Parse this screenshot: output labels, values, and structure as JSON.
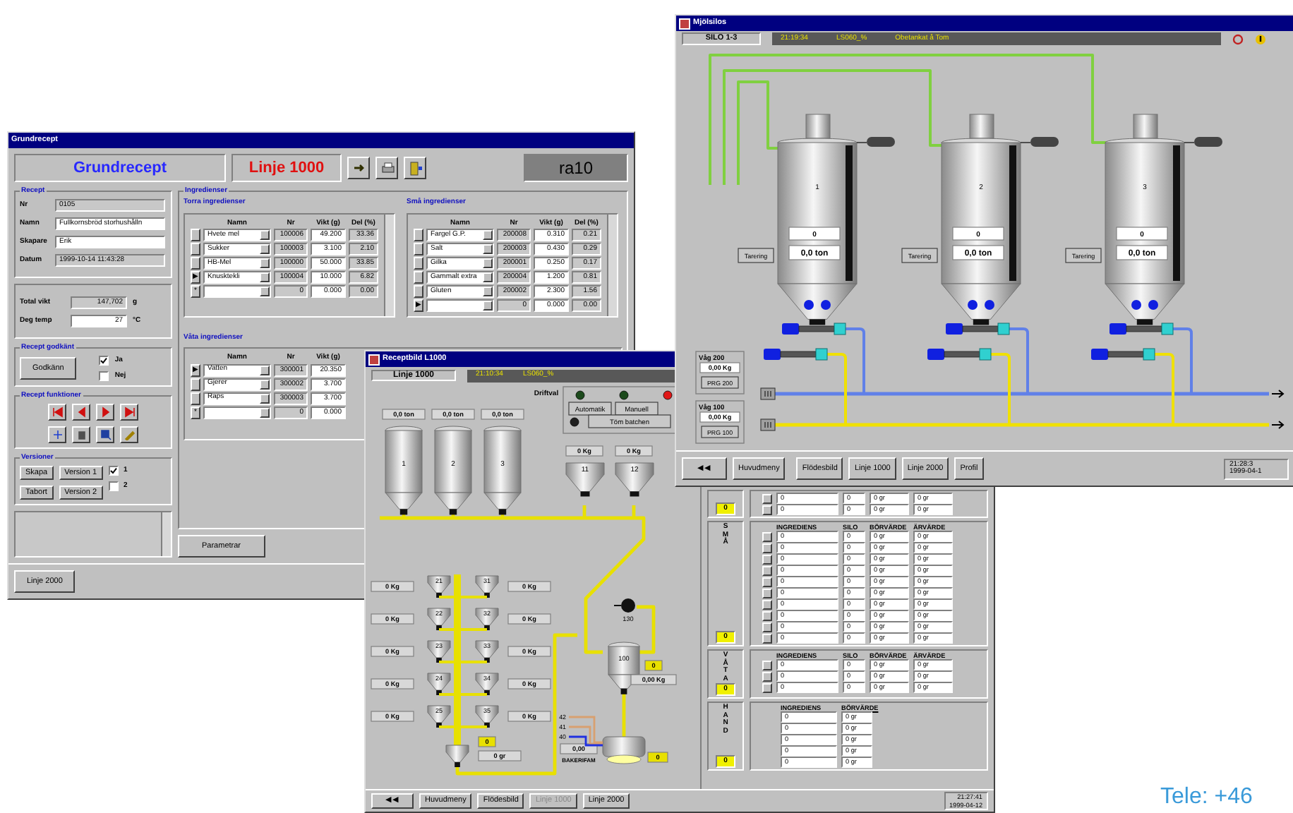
{
  "windows": [
    {
      "kind": "recipe",
      "title": "Grundrecept",
      "heading": "Grundrecept",
      "line": "Linje 1000",
      "code": "ra10",
      "recept": {
        "legend": "Recept",
        "fields": [
          {
            "label": "Nr",
            "value": "0105",
            "editable": false
          },
          {
            "label": "Namn",
            "value": "Fullkornsbröd storhushålln",
            "editable": true
          },
          {
            "label": "Skapare",
            "value": "Erik",
            "editable": true
          },
          {
            "label": "Datum",
            "value": "1999-10-14 11:43:28",
            "editable": false
          }
        ]
      },
      "totals": [
        {
          "label": "Total vikt",
          "value": "147,702",
          "unit": "g",
          "editable": false
        },
        {
          "label": "Deg temp",
          "value": "27",
          "unit": "°C",
          "editable": true
        }
      ],
      "approval": {
        "legend": "Recept godkänt",
        "button": "Godkänn",
        "options": [
          {
            "label": "Ja",
            "checked": true
          },
          {
            "label": "Nej",
            "checked": false
          }
        ]
      },
      "functions": {
        "legend": "Recept funktioner"
      },
      "versions": {
        "legend": "Versioner",
        "buttons": [
          "Skapa",
          "Version 1",
          "Tabort",
          "Version 2"
        ],
        "options": [
          {
            "label": "1",
            "checked": true
          },
          {
            "label": "2",
            "checked": false
          }
        ]
      },
      "parameters_button": "Parametrar",
      "footer_button": "Linje 2000",
      "ingredients": {
        "legend": "Ingredienser",
        "tables": [
          {
            "title": "Torra ingredienser",
            "columns": [
              "Namn",
              "Nr",
              "Vikt (g)",
              "Del (%)"
            ],
            "rows": [
              {
                "name": "Hvete mel",
                "nr": "100006",
                "weight": "49.200",
                "share": "33.36"
              },
              {
                "name": "Sukker",
                "nr": "100003",
                "weight": "3.100",
                "share": "2.10"
              },
              {
                "name": "HB-Mel",
                "nr": "100000",
                "weight": "50.000",
                "share": "33.85"
              },
              {
                "marker": "▶",
                "name": "Knusktekli",
                "nr": "100004",
                "weight": "10.000",
                "share": "6.82"
              },
              {
                "marker": "*",
                "nr": "0",
                "weight": "0.000",
                "share": "0.00"
              }
            ]
          },
          {
            "title": "Små ingredienser",
            "columns": [
              "Namn",
              "Nr",
              "Vikt (g)",
              "Del (%)"
            ],
            "rows": [
              {
                "name": "Fargel G.P.",
                "nr": "200008",
                "weight": "0.310",
                "share": "0.21"
              },
              {
                "name": "Salt",
                "nr": "200003",
                "weight": "0.430",
                "share": "0.29"
              },
              {
                "name": "Gilka",
                "nr": "200001",
                "weight": "0.250",
                "share": "0.17"
              },
              {
                "name": "Gammalt extra",
                "nr": "200004",
                "weight": "1.200",
                "share": "0.81"
              },
              {
                "name": "Gluten",
                "nr": "200002",
                "weight": "2.300",
                "share": "1.56"
              },
              {
                "marker": "▶",
                "nr": "0",
                "weight": "0.000",
                "share": "0.00"
              }
            ]
          },
          {
            "title": "Våta ingredienser",
            "columns": [
              "Namn",
              "Nr",
              "Vikt (g)"
            ],
            "rows": [
              {
                "marker": "▶",
                "name": "Vatten",
                "nr": "300001",
                "weight": "20.350"
              },
              {
                "name": "Gjerer",
                "nr": "300002",
                "weight": "3.700"
              },
              {
                "name": "Raps",
                "nr": "300003",
                "weight": "3.700"
              },
              {
                "marker": "*",
                "nr": "0",
                "weight": "0.000"
              }
            ]
          }
        ]
      }
    },
    {
      "kind": "process",
      "title": "Receptbild L1000",
      "line": "Linje 1000",
      "status": [
        "21:10:34",
        "LS060_%"
      ],
      "mode": {
        "label": "Driftval",
        "lamps": [
          {
            "color": "#1c4a1c"
          },
          {
            "color": "#1c4a1c"
          },
          {
            "color": "#e01818"
          },
          {
            "color": "#202020"
          }
        ],
        "buttons": [
          "Automatik",
          "Manuell"
        ],
        "wide_button": "Töm batchen"
      },
      "silos": [
        {
          "label": "1",
          "reading": "0,0 ton"
        },
        {
          "label": "2",
          "reading": "0,0 ton"
        },
        {
          "label": "3",
          "reading": "0,0 ton"
        }
      ],
      "hoppers": [
        {
          "label": "11",
          "reading": "0 Kg"
        },
        {
          "label": "12",
          "reading": "0 Kg"
        }
      ],
      "small_hoppers_left": [
        {
          "label": "21",
          "reading": "0 Kg"
        },
        {
          "label": "22",
          "reading": "0 Kg"
        },
        {
          "label": "23",
          "reading": "0 Kg"
        },
        {
          "label": "24",
          "reading": "0 Kg"
        },
        {
          "label": "25",
          "reading": "0 Kg"
        }
      ],
      "small_hoppers_right": [
        {
          "label": "31",
          "reading": "0 Kg"
        },
        {
          "label": "32",
          "reading": "0 Kg"
        },
        {
          "label": "33",
          "reading": "0 Kg"
        },
        {
          "label": "34",
          "reading": "0 Kg"
        },
        {
          "label": "35",
          "reading": "0 Kg"
        }
      ],
      "collector": {
        "counter": "0",
        "reading": "0 gr"
      },
      "scale": {
        "label": "100",
        "counter": "0",
        "reading": "0,00 Kg"
      },
      "pump": {
        "label": "130"
      },
      "mixer": {
        "label": "BAKERIFAM",
        "reading": "0,00",
        "counter": "0"
      },
      "feeds": [
        {
          "label": "42",
          "color": "#d8a070"
        },
        {
          "label": "41",
          "color": "#d8a070"
        },
        {
          "label": "40",
          "color": "#2030e0"
        }
      ],
      "sections": [
        {
          "counter": "0",
          "rows": [
            [
              "0",
              "0",
              "0 gr",
              "0 gr"
            ],
            [
              "0",
              "0",
              "0 gr",
              "0 gr"
            ]
          ]
        },
        {
          "side": "SMÅ",
          "counter": "0",
          "columns": [
            "INGREDIENS",
            "SILO",
            "BÖRVÄRDE",
            "ÄRVÄRDE"
          ],
          "rows": [
            [
              "0",
              "0",
              "0 gr",
              "0 gr"
            ],
            [
              "0",
              "0",
              "0 gr",
              "0 gr"
            ],
            [
              "0",
              "0",
              "0 gr",
              "0 gr"
            ],
            [
              "0",
              "0",
              "0 gr",
              "0 gr"
            ],
            [
              "0",
              "0",
              "0 gr",
              "0 gr"
            ],
            [
              "0",
              "0",
              "0 gr",
              "0 gr"
            ],
            [
              "0",
              "0",
              "0 gr",
              "0 gr"
            ],
            [
              "0",
              "0",
              "0 gr",
              "0 gr"
            ],
            [
              "0",
              "0",
              "0 gr",
              "0 gr"
            ],
            [
              "0",
              "0",
              "0 gr",
              "0 gr"
            ]
          ]
        },
        {
          "side": "VÅTA",
          "counter": "0",
          "columns": [
            "INGREDIENS",
            "SILO",
            "BÖRVÄRDE",
            "ÄRVÄRDE"
          ],
          "rows": [
            [
              "0",
              "0",
              "0 gr",
              "0 gr"
            ],
            [
              "0",
              "0",
              "0 gr",
              "0 gr"
            ],
            [
              "0",
              "0",
              "0 gr",
              "0 gr"
            ]
          ]
        },
        {
          "side": "HAND",
          "counter": "0",
          "columns": [
            "INGREDIENS",
            "BÖRVÄRDE"
          ],
          "rows": [
            [
              "0",
              "0 gr"
            ],
            [
              "0",
              "0 gr"
            ],
            [
              "0",
              "0 gr"
            ],
            [
              "0",
              "0 gr"
            ],
            [
              "0",
              "0 gr"
            ]
          ]
        }
      ],
      "time": [
        "21:27:41",
        "1999-04-12"
      ],
      "footer": [
        {
          "label": "◀◀",
          "disabled": false
        },
        {
          "label": "Huvudmeny",
          "disabled": false
        },
        {
          "label": "Flödesbild",
          "disabled": false
        },
        {
          "label": "Linje 1000",
          "disabled": true
        },
        {
          "label": "Linje 2000",
          "disabled": false
        }
      ]
    },
    {
      "kind": "silo",
      "title": "Mjölsilos",
      "name": "SILO 1-3",
      "status": [
        "21:19:34",
        "LS060_%",
        "Obetankat å Tom"
      ],
      "silos": [
        {
          "label": "1",
          "counter": "0",
          "reading": "0,0 ton",
          "button": "Tarering"
        },
        {
          "label": "2",
          "counter": "0",
          "reading": "0,0 ton",
          "button": "Tarering"
        },
        {
          "label": "3",
          "counter": "0",
          "reading": "0,0 ton",
          "button": "Tarering"
        }
      ],
      "scales": [
        {
          "label": "Våg 200",
          "reading": "0,00 Kg",
          "button": "PRG 200"
        },
        {
          "label": "Våg 100",
          "reading": "0,00 Kg",
          "button": "PRG 100"
        }
      ],
      "footer": [
        {
          "label": "◀◀",
          "disabled": false
        },
        {
          "label": "Huvudmeny",
          "disabled": false
        },
        {
          "label": "Flödesbild",
          "disabled": false
        },
        {
          "label": "Linje 1000",
          "disabled": false
        },
        {
          "label": "Linje 2000",
          "disabled": false
        },
        {
          "label": "Profil",
          "disabled": false
        }
      ],
      "time": [
        "21:28:3",
        "1999-04-1"
      ]
    }
  ],
  "caption": "Tele: +46"
}
